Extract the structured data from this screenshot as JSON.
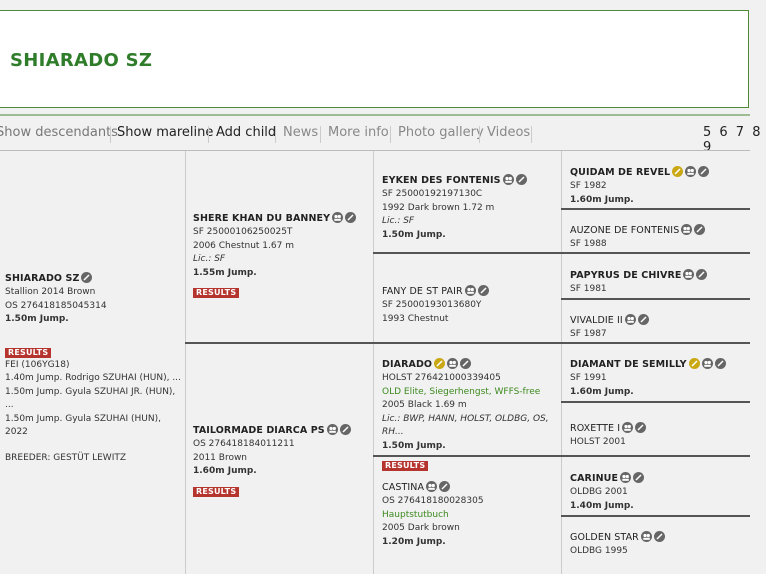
{
  "horse": {
    "title": "SHIARADO SZ"
  },
  "nav": {
    "items": [
      "Show descendants",
      "Show mareline",
      "Add child",
      "News",
      "More info",
      "Photo gallery",
      "Videos"
    ],
    "pages": "5 6 7 8 9"
  },
  "subject": {
    "name": "SHIARADO SZ",
    "line1": "Stallion 2014 Brown",
    "line2": "OS 276418185045314",
    "line3": "1.50m Jump.",
    "results": "RESULTS",
    "fei": "FEI (106YG18)",
    "r1": "1.40m Jump. Rodrigo SZUHAI (HUN), ...",
    "r2": "1.50m Jump. Gyula SZUHAI JR. (HUN), ...",
    "r3": "1.50m Jump. Gyula SZUHAI (HUN), 2022",
    "breeder": "BREEDER: GESTÜT LEWITZ"
  },
  "sire": {
    "name": "SHERE KHAN DU BANNEY",
    "line1": "SF 25000106250025T",
    "line2": "2006 Chestnut 1.67 m",
    "lic": "Lic.: SF",
    "jump": "1.55m Jump.",
    "results": "RESULTS"
  },
  "dam": {
    "name": "TAILORMADE DIARCA PS",
    "line1": "OS 276418184011211",
    "line2": "2011 Brown",
    "jump": "1.60m Jump.",
    "results": "RESULTS"
  },
  "ss": {
    "name": "EYKEN DES FONTENIS",
    "line1": "SF 25000192197130C",
    "line2": "1992 Dark brown 1.72 m",
    "lic": "Lic.: SF",
    "jump": "1.50m Jump."
  },
  "sd": {
    "name": "FANY DE ST PAIR",
    "line1": "SF 25000193013680Y",
    "line2": "1993 Chestnut"
  },
  "ds": {
    "name": "DIARADO",
    "line1": "HOLST 276421000339405",
    "line2": "OLD Elite, Siegerhengst, WFFS-free",
    "line3": "2005 Black 1.69 m",
    "lic": "Lic.: BWP, HANN, HOLST, OLDBG, OS, RH...",
    "jump": "1.50m Jump.",
    "results": "RESULTS"
  },
  "dd": {
    "name": "CASTINA",
    "line1": "OS 276418180028305",
    "line2": "Hauptstutbuch",
    "line3": "2005 Dark brown",
    "jump": "1.20m Jump."
  },
  "g4": [
    {
      "name": "QUIDAM DE REVEL",
      "line1": "SF 1982",
      "line2": "1.60m Jump."
    },
    {
      "name": "AUZONE DE FONTENIS",
      "line1": "SF 1988",
      "line2": ""
    },
    {
      "name": "PAPYRUS DE CHIVRE",
      "line1": "SF 1981",
      "line2": ""
    },
    {
      "name": "VIVALDIE II",
      "line1": "SF 1987",
      "line2": ""
    },
    {
      "name": "DIAMANT DE SEMILLY",
      "line1": "SF 1991",
      "line2": "1.60m Jump."
    },
    {
      "name": "ROXETTE I",
      "line1": "HOLST 2001",
      "line2": ""
    },
    {
      "name": "CARINUE",
      "line1": "OLDBG 2001",
      "line2": "1.40m Jump."
    },
    {
      "name": "GOLDEN STAR",
      "line1": "OLDBG 1995",
      "line2": ""
    }
  ],
  "colors": {
    "brand_green": "#2f7d2a",
    "results_red": "#b5342e",
    "icon_grey": "#666666",
    "icon_gold": "#c9a814"
  },
  "icons": [
    "people-icon",
    "edit-icon",
    "premium-icon"
  ]
}
